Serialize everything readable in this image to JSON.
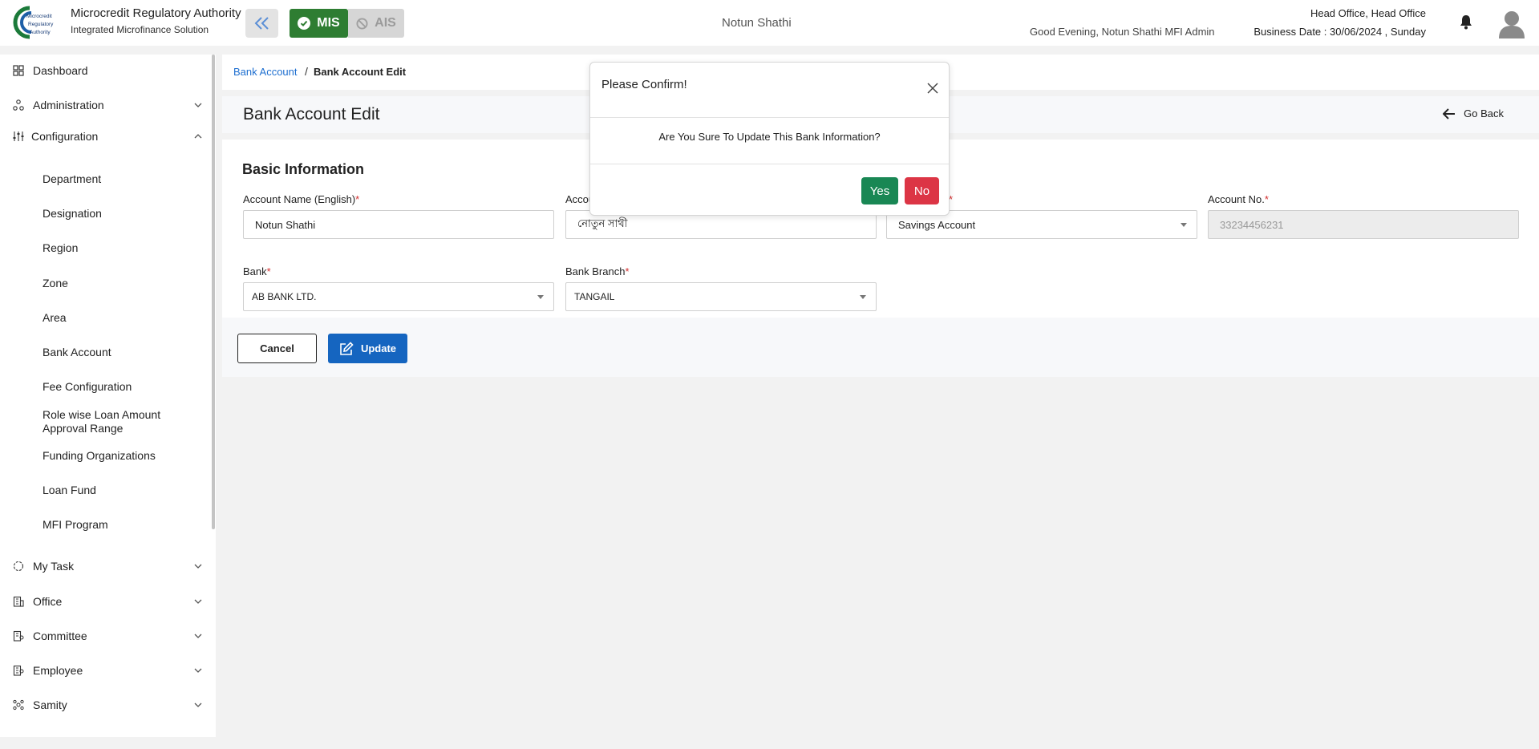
{
  "header": {
    "logo_text": [
      "Microcredit",
      "Regulatory",
      "Authority"
    ],
    "brand_title": "Microcredit Regulatory Authority",
    "brand_subtitle": "Integrated Microfinance Solution",
    "mis_label": "MIS",
    "ais_label": "AIS",
    "org_name": "Notun Shathi",
    "greeting": "Good Evening, Notun Shathi MFI Admin",
    "office": "Head Office, Head Office",
    "business_date": "Business Date : 30/06/2024 , Sunday",
    "mis_color": "#2e7d32"
  },
  "sidebar": {
    "dashboard": "Dashboard",
    "administration": "Administration",
    "configuration": "Configuration",
    "config_items": [
      "Department",
      "Designation",
      "Region",
      "Zone",
      "Area",
      "Bank Account",
      "Fee Configuration",
      "Role wise Loan Amount Approval Range",
      "Funding Organizations",
      "Loan Fund",
      "MFI Program"
    ],
    "my_task": "My Task",
    "office": "Office",
    "committee": "Committee",
    "employee": "Employee",
    "samity": "Samity"
  },
  "breadcrumb": {
    "parent": "Bank Account",
    "separator": "/",
    "current": "Bank Account Edit"
  },
  "page": {
    "title": "Bank Account Edit",
    "go_back": "Go Back"
  },
  "form": {
    "section_title": "Basic Information",
    "account_name_en": {
      "label": "Account Name (English)",
      "value": "Notun Shathi"
    },
    "account_name_bn": {
      "label": "Accou",
      "value": "নোতুন সাথী"
    },
    "account_type": {
      "value": "Savings Account"
    },
    "account_no": {
      "label": "Account No.",
      "value": "33234456231"
    },
    "bank": {
      "label": "Bank",
      "value": "AB BANK LTD."
    },
    "bank_branch": {
      "label": "Bank Branch",
      "value": "TANGAIL"
    },
    "required_mark": "*"
  },
  "actions": {
    "cancel": "Cancel",
    "update": "Update"
  },
  "modal": {
    "title": "Please Confirm!",
    "message": "Are You Sure To Update This Bank Information?",
    "yes": "Yes",
    "no": "No"
  }
}
